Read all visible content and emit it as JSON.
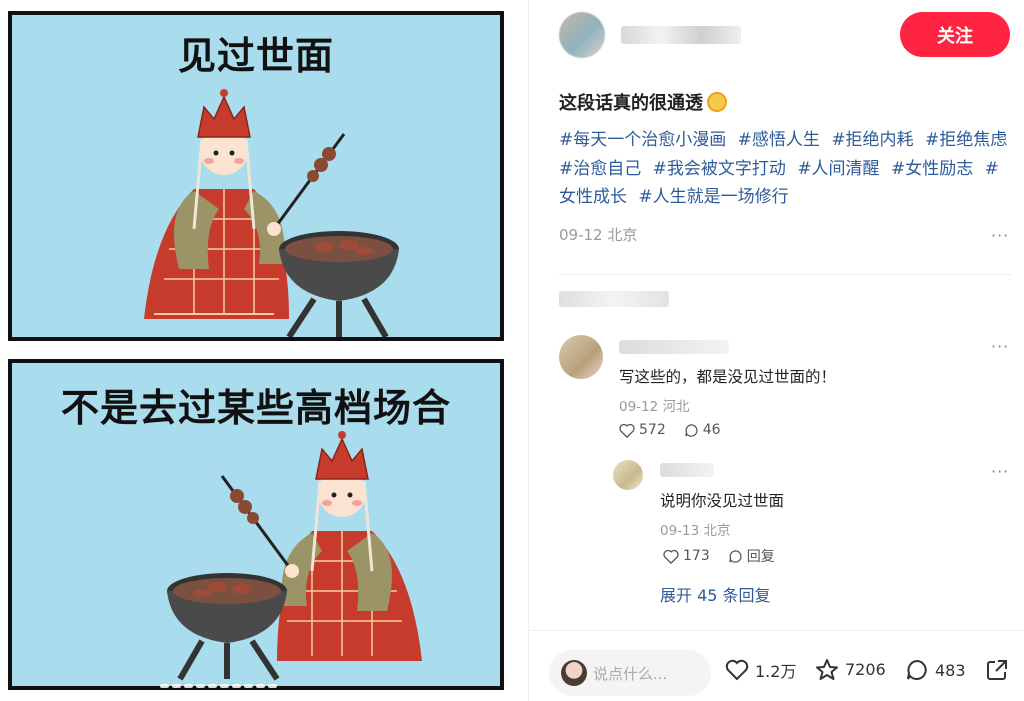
{
  "media": {
    "panels": [
      {
        "caption": "见过世面"
      },
      {
        "caption": "不是去过某些高档场合"
      }
    ],
    "page_indicator": {
      "count": 10
    }
  },
  "author": {
    "follow_label": "关注"
  },
  "post": {
    "title": "这段话真的很通透",
    "tags": [
      "#每天一个治愈小漫画",
      "#感悟人生",
      "#拒绝内耗",
      "#拒绝焦虑",
      "#治愈自己",
      "#我会被文字打动",
      "#人间清醒",
      "#女性励志",
      "#女性成长",
      "#人生就是一场修行"
    ],
    "meta": "09-12 北京"
  },
  "comments": [
    {
      "text": "写这些的，都是没见过世面的！",
      "meta": "09-12 河北",
      "likes": "572",
      "replies": "46"
    },
    {
      "text": "说明你没见过世面",
      "meta": "09-13 北京",
      "likes": "173",
      "reply_label": "回复"
    }
  ],
  "expand_label": "展开 45 条回复",
  "footer": {
    "input_placeholder": "说点什么...",
    "likes": "1.2万",
    "stars": "7206",
    "comments": "483"
  },
  "colors": {
    "accent": "#ff2442",
    "tag": "#2e5b9a",
    "panel_bg": "#a9dcec"
  }
}
